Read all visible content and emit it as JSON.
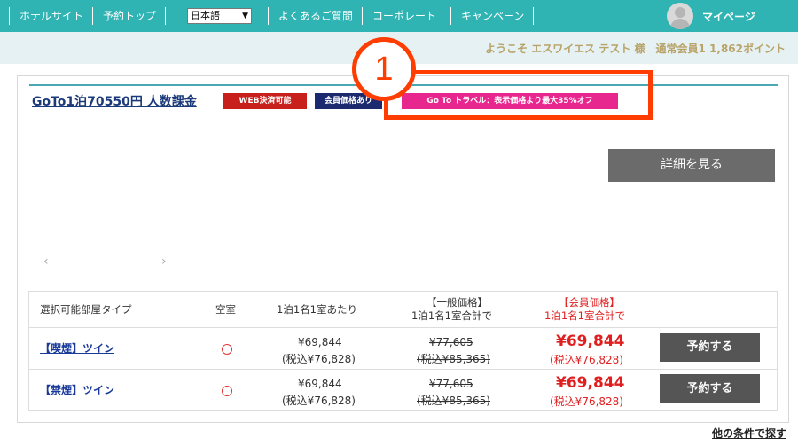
{
  "nav": {
    "hotel_site": "ホテルサイト",
    "booking_top": "予約トップ",
    "language": "日本語",
    "faq": "よくあるご質問",
    "corporate": "コーポレート",
    "campaign": "キャンペーン",
    "mypage": "マイページ"
  },
  "welcome": "ようこそ エスワイエス テスト 様　通常会員1 1,862ポイント",
  "plan": {
    "title": "GoTo1泊70550円 人数課金",
    "badges": {
      "web_payment": "WEB決済可能",
      "member_price": "会員価格あり",
      "goto": "Go To トラベル：表示価格より最大35%オフ"
    },
    "detail_button": "詳細を見る",
    "prev_arrow": "‹",
    "next_arrow": "›"
  },
  "annotation": {
    "number": "1",
    "color": "#ff3d00"
  },
  "table": {
    "headers": {
      "room_type": "選択可能部屋タイプ",
      "vacancy": "空室",
      "per_person": "1泊1名1室あたり",
      "general_line1": "【一般価格】",
      "general_line2": "1泊1名1室合計で",
      "member_line1": "【会員価格】",
      "member_line2": "1泊1名1室合計で"
    },
    "rows": [
      {
        "room": "【喫煙】ツイン",
        "vacancy": "○",
        "price": "¥69,844",
        "price_tax": "(税込¥76,828)",
        "general": "¥77,605",
        "general_tax": "(税込¥85,365)",
        "member": "¥69,844",
        "member_tax": "(税込¥76,828)",
        "button": "予約する"
      },
      {
        "room": "【禁煙】ツイン",
        "vacancy": "○",
        "price": "¥69,844",
        "price_tax": "(税込¥76,828)",
        "general": "¥77,605",
        "general_tax": "(税込¥85,365)",
        "member": "¥69,844",
        "member_tax": "(税込¥76,828)",
        "button": "予約する"
      }
    ]
  },
  "other_conditions": "他の条件で探す",
  "colors": {
    "header_teal": "#2fb3b3",
    "web_badge": "#c8201c",
    "member_badge": "#1b2a6e",
    "goto_badge": "#e8278e",
    "member_price_red": "#e02020"
  }
}
